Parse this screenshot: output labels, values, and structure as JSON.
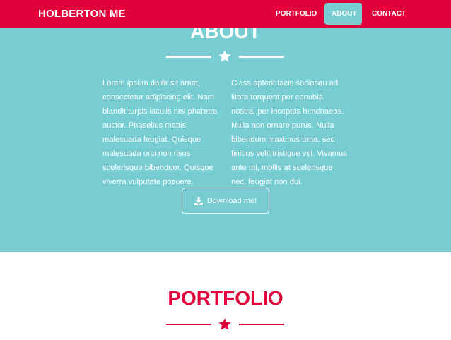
{
  "nav": {
    "brand": "HOLBERTON ME",
    "links": [
      "PORTFOLIO",
      "ABOUT",
      "CONTACT"
    ],
    "active": "ABOUT"
  },
  "about": {
    "title": "ABOUT",
    "col1": "Lorem ipsum dolor sit amet, consectetur adipiscing elit. Nam blandit turpis iaculis nisl pharetra auctor. Phasellus mattis malesuada feugiat. Quisque malesuada orci non risus scelerisque bibendum. Quisque viverra vulputate posuere.",
    "col2": "Class aptent taciti sociosqu ad litora torquent per conubia nostra, per inceptos himenaeos. Nulla non ornare purus. Nulla bibendum maximus urna, sed finibus velit tristique vel. Vivamus ante mi, mollis at scelerisque nec, feugiat non dui.",
    "download": "Download me!"
  },
  "portfolio": {
    "title": "PORTFOLIO"
  },
  "colors": {
    "primary": "#e0003a",
    "secondary": "#78cdd3"
  }
}
